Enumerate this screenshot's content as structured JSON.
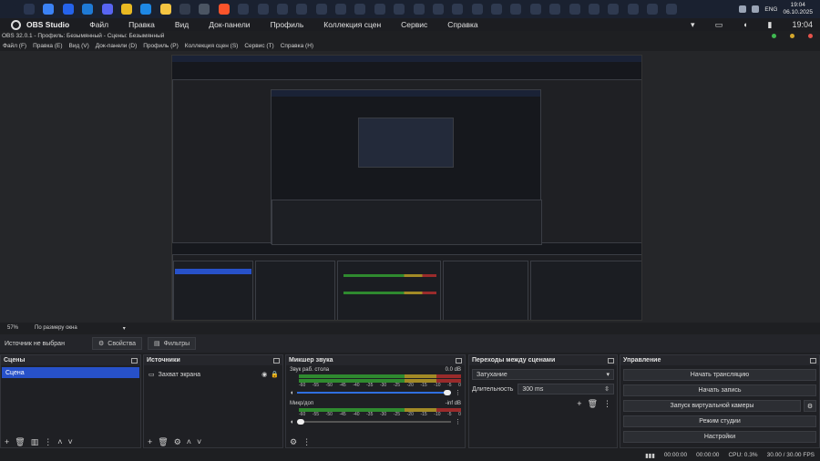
{
  "taskbar": {
    "icons": [
      {
        "name": "start-icon",
        "color": "#1a2130"
      },
      {
        "name": "search-icon",
        "color": "#2a3650"
      },
      {
        "name": "file-manager-icon",
        "color": "#3b82f6"
      },
      {
        "name": "calendar-icon",
        "color": "#2563eb"
      },
      {
        "name": "edge-icon",
        "color": "#1f7ad6"
      },
      {
        "name": "discord-icon",
        "color": "#5865f2"
      },
      {
        "name": "chrome-icon",
        "color": "#e8b923"
      },
      {
        "name": "vscode-icon",
        "color": "#1e88e5"
      },
      {
        "name": "folder-icon",
        "color": "#f5c542"
      },
      {
        "name": "terminal-icon",
        "color": "#333c4d"
      },
      {
        "name": "settings-icon",
        "color": "#4b5563"
      },
      {
        "name": "brave-icon",
        "color": "#fb542b"
      }
    ],
    "clock_time": "19:04",
    "clock_date": "06.10.2025",
    "lang": "ENG"
  },
  "obs_menubar": {
    "app_name": "OBS Studio",
    "items": [
      "Файл",
      "Правка",
      "Вид",
      "Док-панели",
      "Профиль",
      "Коллекция сцен",
      "Сервис",
      "Справка"
    ],
    "time": "19:04"
  },
  "title": "OBS 32.0.1 - Профиль: Безымянный - Сцены: Безымянный",
  "app_menu": [
    "Файл (F)",
    "Правка (E)",
    "Вид (V)",
    "Док-панели (D)",
    "Профиль (P)",
    "Коллекция сцен (S)",
    "Сервис (T)",
    "Справка (H)"
  ],
  "preview_status": {
    "zoom": "57%",
    "fit": "По размеру окна"
  },
  "source_bar": {
    "no_source": "Источник не выбран",
    "properties": "Свойства",
    "filters": "Фильтры"
  },
  "scenes": {
    "title": "Сцены",
    "items": [
      "Сцена"
    ]
  },
  "sources": {
    "title": "Источники",
    "items": [
      "Захват экрана"
    ]
  },
  "mixer": {
    "title": "Микшер звука",
    "channels": [
      {
        "name": "Звук раб. стола",
        "db": "0.0 dB"
      },
      {
        "name": "Микр/доп",
        "db": "-inf dB"
      }
    ],
    "ticks": [
      "-60",
      "-55",
      "-50",
      "-45",
      "-40",
      "-35",
      "-30",
      "-25",
      "-20",
      "-15",
      "-10",
      "-5",
      "0"
    ]
  },
  "transitions": {
    "title": "Переходы между сценами",
    "type": "Затухание",
    "duration_label": "Длительность",
    "duration_value": "300 ms"
  },
  "controls": {
    "title": "Управление",
    "start_stream": "Начать трансляцию",
    "start_record": "Начать запись",
    "virtual_cam": "Запуск виртуальной камеры",
    "studio_mode": "Режим студии",
    "settings": "Настройки"
  },
  "status": {
    "rec_time": "00:00:00",
    "stream_time": "00:00:00",
    "cpu": "CPU: 0.3%",
    "fps": "30.00 / 30.00 FPS"
  },
  "colors": {
    "accent": "#2751c9",
    "taskbar": "#1a2130"
  }
}
